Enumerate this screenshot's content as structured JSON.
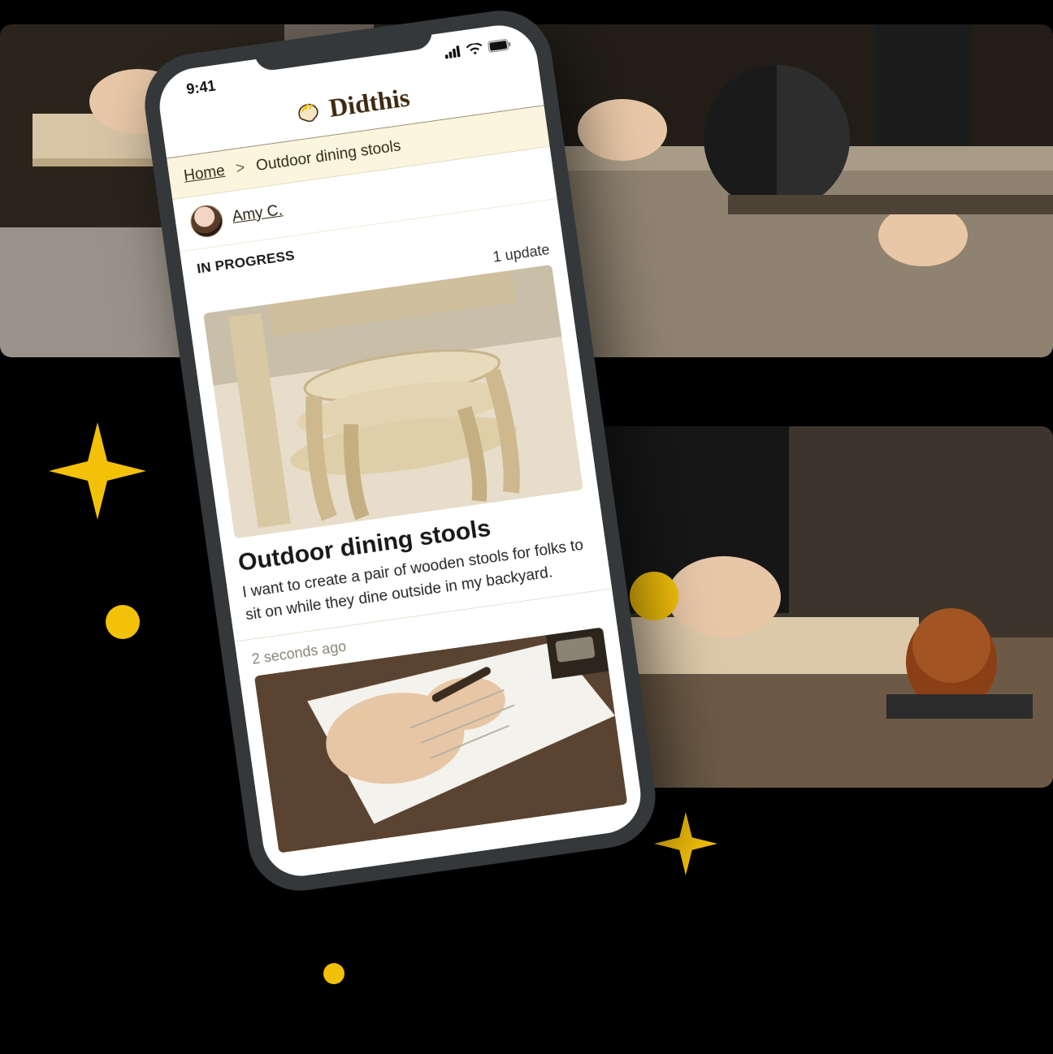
{
  "status_bar": {
    "time": "9:41"
  },
  "brand": {
    "name": "Didthis"
  },
  "breadcrumb": {
    "home_label": "Home",
    "separator": ">",
    "current": "Outdoor dining stools"
  },
  "user": {
    "name": "Amy C."
  },
  "project": {
    "status_label": "IN PROGRESS",
    "update_count_label": "1 update",
    "title": "Outdoor dining stools",
    "description": "I want to create a pair of wooden stools for folks to sit on while they dine outside in my backyard."
  },
  "feed": {
    "items": [
      {
        "timestamp": "2 seconds ago"
      }
    ]
  },
  "decor": {
    "accent_color": "#f4c109"
  }
}
